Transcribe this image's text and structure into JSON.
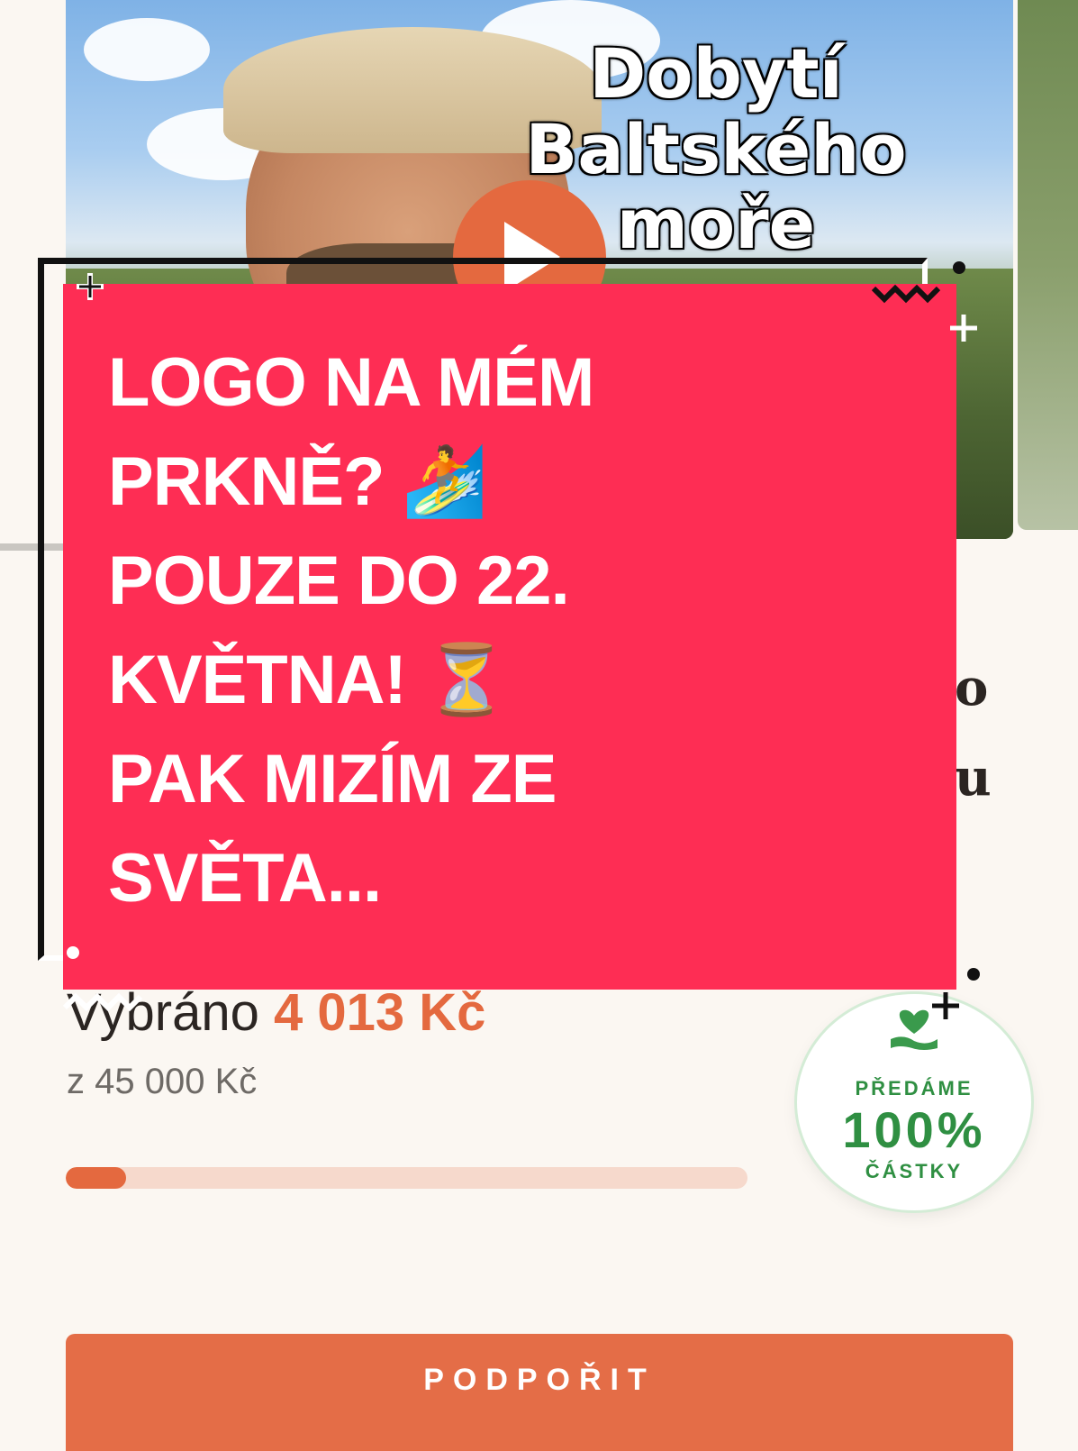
{
  "video": {
    "title_lines": [
      "Dobytí",
      "Baltského",
      "moře"
    ],
    "play_icon": "play-icon",
    "play_color": "#e4693f"
  },
  "promo": {
    "background": "#fe2d54",
    "lines": [
      "LOGO NA MÉM",
      "PRKNĚ? 🏄",
      "POUZE DO 22.",
      "KVĚTNA! ⏳",
      "PAK MIZÍM ZE",
      "SVĚTA..."
    ]
  },
  "funding": {
    "raised_label": "Vybráno",
    "raised_amount": "4 013 Kč",
    "goal_text": "z 45 000 Kč",
    "progress_fraction": 0.089,
    "accent": "#e4693f"
  },
  "badge": {
    "icon": "heart-hand-icon",
    "line1": "PŘEDÁME",
    "line2": "100%",
    "line3": "ČÁSTKY",
    "color": "#2f8f42"
  },
  "actions": {
    "support_label": "PODPOŘIT"
  },
  "peek": {
    "line1": "o",
    "line2": "u"
  }
}
